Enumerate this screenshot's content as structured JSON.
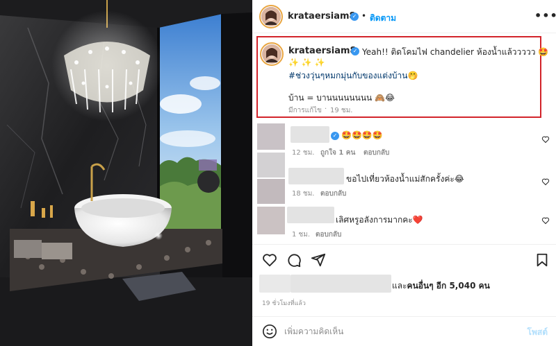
{
  "post": {
    "username": "krataersiam8",
    "follow_label": "ติดตาม",
    "more_label": "•••",
    "caption": {
      "line1": "Yeah!! ติดโคมไฟ chandelier ห้องน้ำแล้ววววว 🤩",
      "line2": "✨ ✨ ✨",
      "hashtag": "#ช่วงวุ่นๆหมกมุ่นกับของแต่งบ้าน🤭",
      "line4": "บ้าน = บานนนนนนนน 🙈😂",
      "edited_label": "มีการแก้ไข",
      "time": "19 ชม."
    }
  },
  "comments": [
    {
      "text": "🤩🤩🤩🤩",
      "time": "12 ชม.",
      "likes_label": "ถูกใจ 1 คน",
      "reply_label": "ตอบกลับ"
    },
    {
      "text": "ขอไปเที่ยวห้องน้ำแม่สักครั้งค่ะ😂",
      "time": "18 ชม.",
      "likes_label": "",
      "reply_label": "ตอบกลับ"
    },
    {
      "text": "เลิศหรูอลังการมากคะ❤️",
      "time": "1 ชม.",
      "likes_label": "",
      "reply_label": "ตอบกลับ"
    }
  ],
  "likes": {
    "prefix": "และ",
    "bold": "คนอื่นๆ อีก 5,040 คน"
  },
  "time_ago": "19 ชั่วโมงที่แล้ว",
  "add_comment": {
    "placeholder": "เพิ่มความคิดเห็น",
    "post_label": "โพสต์"
  },
  "colors": {
    "accent": "#0095f6",
    "highlight_border": "#d2232a",
    "verified": "#3897f0"
  },
  "icons": [
    "heart-icon",
    "comment-icon",
    "share-icon",
    "save-icon",
    "emoji-icon",
    "verified-icon"
  ]
}
